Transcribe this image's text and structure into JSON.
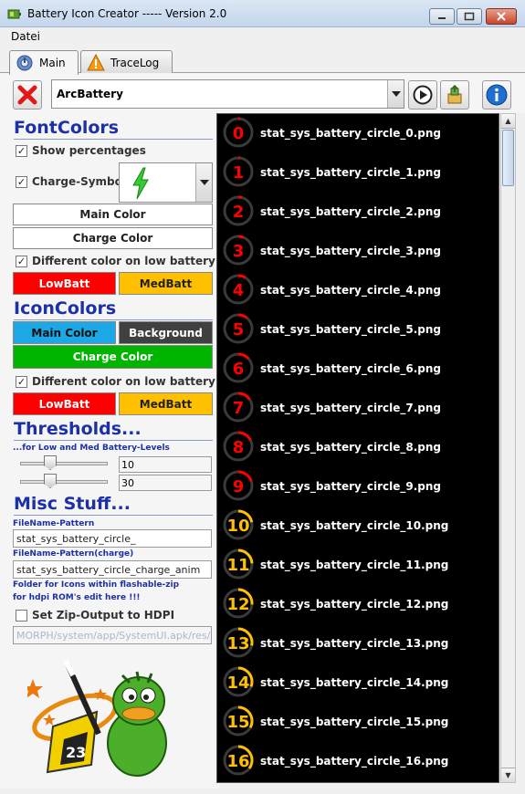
{
  "window": {
    "title": "Battery Icon Creator ----- Version 2.0"
  },
  "menu": {
    "file_label": "Datei"
  },
  "tabs": [
    {
      "label": "Main"
    },
    {
      "label": "TraceLog"
    }
  ],
  "toolbar": {
    "preset_value": "ArcBattery"
  },
  "font_colors": {
    "title": "FontColors",
    "show_percentages_label": "Show percentages",
    "show_percentages_checked": true,
    "charge_symbol_label": "Charge-Symbol",
    "charge_symbol_checked": true,
    "main_color_label": "Main Color",
    "charge_color_label": "Charge Color",
    "diff_low_label": "Different color on low battery",
    "diff_low_checked": true,
    "lowbatt_label": "LowBatt",
    "medbatt_label": "MedBatt",
    "lowbatt_color": "#ff0000",
    "medbatt_color": "#ffc000"
  },
  "icon_colors": {
    "title": "IconColors",
    "main_color_label": "Main Color",
    "background_label": "Background",
    "charge_color_label": "Charge Color",
    "main_color": "#1ca8e6",
    "background_color": "#404040",
    "charge_color": "#00b400",
    "diff_low_label": "Different color on low battery",
    "diff_low_checked": true,
    "lowbatt_label": "LowBatt",
    "medbatt_label": "MedBatt"
  },
  "thresholds": {
    "title": "Thresholds...",
    "subtitle": "...for Low and Med Battery-Levels",
    "low_value": "10",
    "med_value": "30"
  },
  "misc": {
    "title": "Misc Stuff...",
    "pattern_label": "FileName-Pattern",
    "pattern_value": "stat_sys_battery_circle_",
    "pattern_charge_label": "FileName-Pattern(charge)",
    "pattern_charge_value": "stat_sys_battery_circle_charge_anim",
    "folder_note_1": "Folder for Icons within flashable-zip",
    "folder_note_2": "for hdpi ROM's edit here !!!",
    "zip_hdpi_label": "Set Zip-Output to HDPI",
    "zip_hdpi_checked": false,
    "folder_path_value": "MORPH/system/app/SystemUI.apk/res/"
  },
  "icon_list": [
    {
      "number": "0",
      "file": "stat_sys_battery_circle_0.png"
    },
    {
      "number": "1",
      "file": "stat_sys_battery_circle_1.png"
    },
    {
      "number": "2",
      "file": "stat_sys_battery_circle_2.png"
    },
    {
      "number": "3",
      "file": "stat_sys_battery_circle_3.png"
    },
    {
      "number": "4",
      "file": "stat_sys_battery_circle_4.png"
    },
    {
      "number": "5",
      "file": "stat_sys_battery_circle_5.png"
    },
    {
      "number": "6",
      "file": "stat_sys_battery_circle_6.png"
    },
    {
      "number": "7",
      "file": "stat_sys_battery_circle_7.png"
    },
    {
      "number": "8",
      "file": "stat_sys_battery_circle_8.png"
    },
    {
      "number": "9",
      "file": "stat_sys_battery_circle_9.png"
    },
    {
      "number": "10",
      "file": "stat_sys_battery_circle_10.png"
    },
    {
      "number": "11",
      "file": "stat_sys_battery_circle_11.png"
    },
    {
      "number": "12",
      "file": "stat_sys_battery_circle_12.png"
    },
    {
      "number": "13",
      "file": "stat_sys_battery_circle_13.png"
    },
    {
      "number": "14",
      "file": "stat_sys_battery_circle_14.png"
    },
    {
      "number": "15",
      "file": "stat_sys_battery_circle_15.png"
    },
    {
      "number": "16",
      "file": "stat_sys_battery_circle_16.png"
    }
  ],
  "icons": {
    "delete": "delete-icon",
    "play": "play-icon",
    "export": "export-icon",
    "info": "info-icon",
    "charge_symbol": "lightning-bolt-icon"
  }
}
